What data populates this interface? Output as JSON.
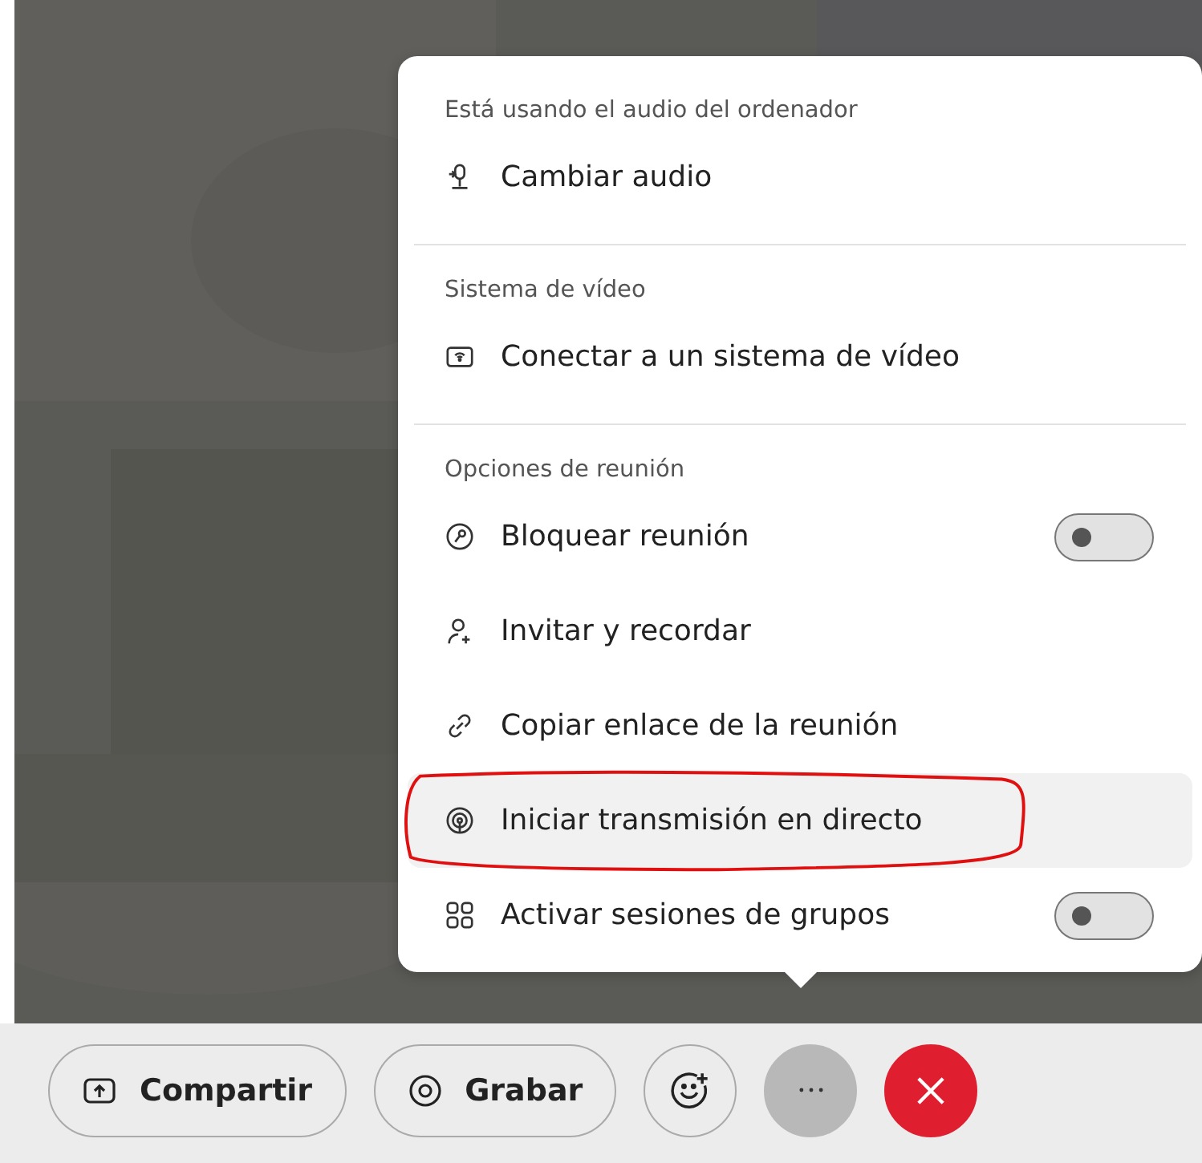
{
  "menu": {
    "sections": [
      {
        "heading": "Está usando el audio del ordenador",
        "items": [
          {
            "label": "Cambiar audio",
            "kind": "action",
            "highlighted": false,
            "annotated": false
          }
        ]
      },
      {
        "heading": "Sistema de vídeo",
        "items": [
          {
            "label": "Conectar a un sistema de vídeo",
            "kind": "action",
            "highlighted": false,
            "annotated": false
          }
        ]
      },
      {
        "heading": "Opciones de reunión",
        "items": [
          {
            "label": "Bloquear reunión",
            "kind": "toggle",
            "on": false,
            "highlighted": false,
            "annotated": false
          },
          {
            "label": "Invitar y recordar",
            "kind": "action",
            "highlighted": false,
            "annotated": false
          },
          {
            "label": "Copiar enlace de la reunión",
            "kind": "action",
            "highlighted": false,
            "annotated": false
          },
          {
            "label": "Iniciar transmisión en directo",
            "kind": "action",
            "highlighted": true,
            "annotated": true
          },
          {
            "label": "Activar sesiones de grupos",
            "kind": "toggle",
            "on": false,
            "highlighted": false,
            "annotated": false
          }
        ]
      }
    ]
  },
  "toolbar": {
    "buttons": [
      {
        "label": "Compartir",
        "kind": "labeled"
      },
      {
        "label": "Grabar",
        "kind": "labeled"
      },
      {
        "kind": "round",
        "selected": false
      },
      {
        "kind": "round",
        "selected": true
      },
      {
        "kind": "end"
      }
    ]
  }
}
